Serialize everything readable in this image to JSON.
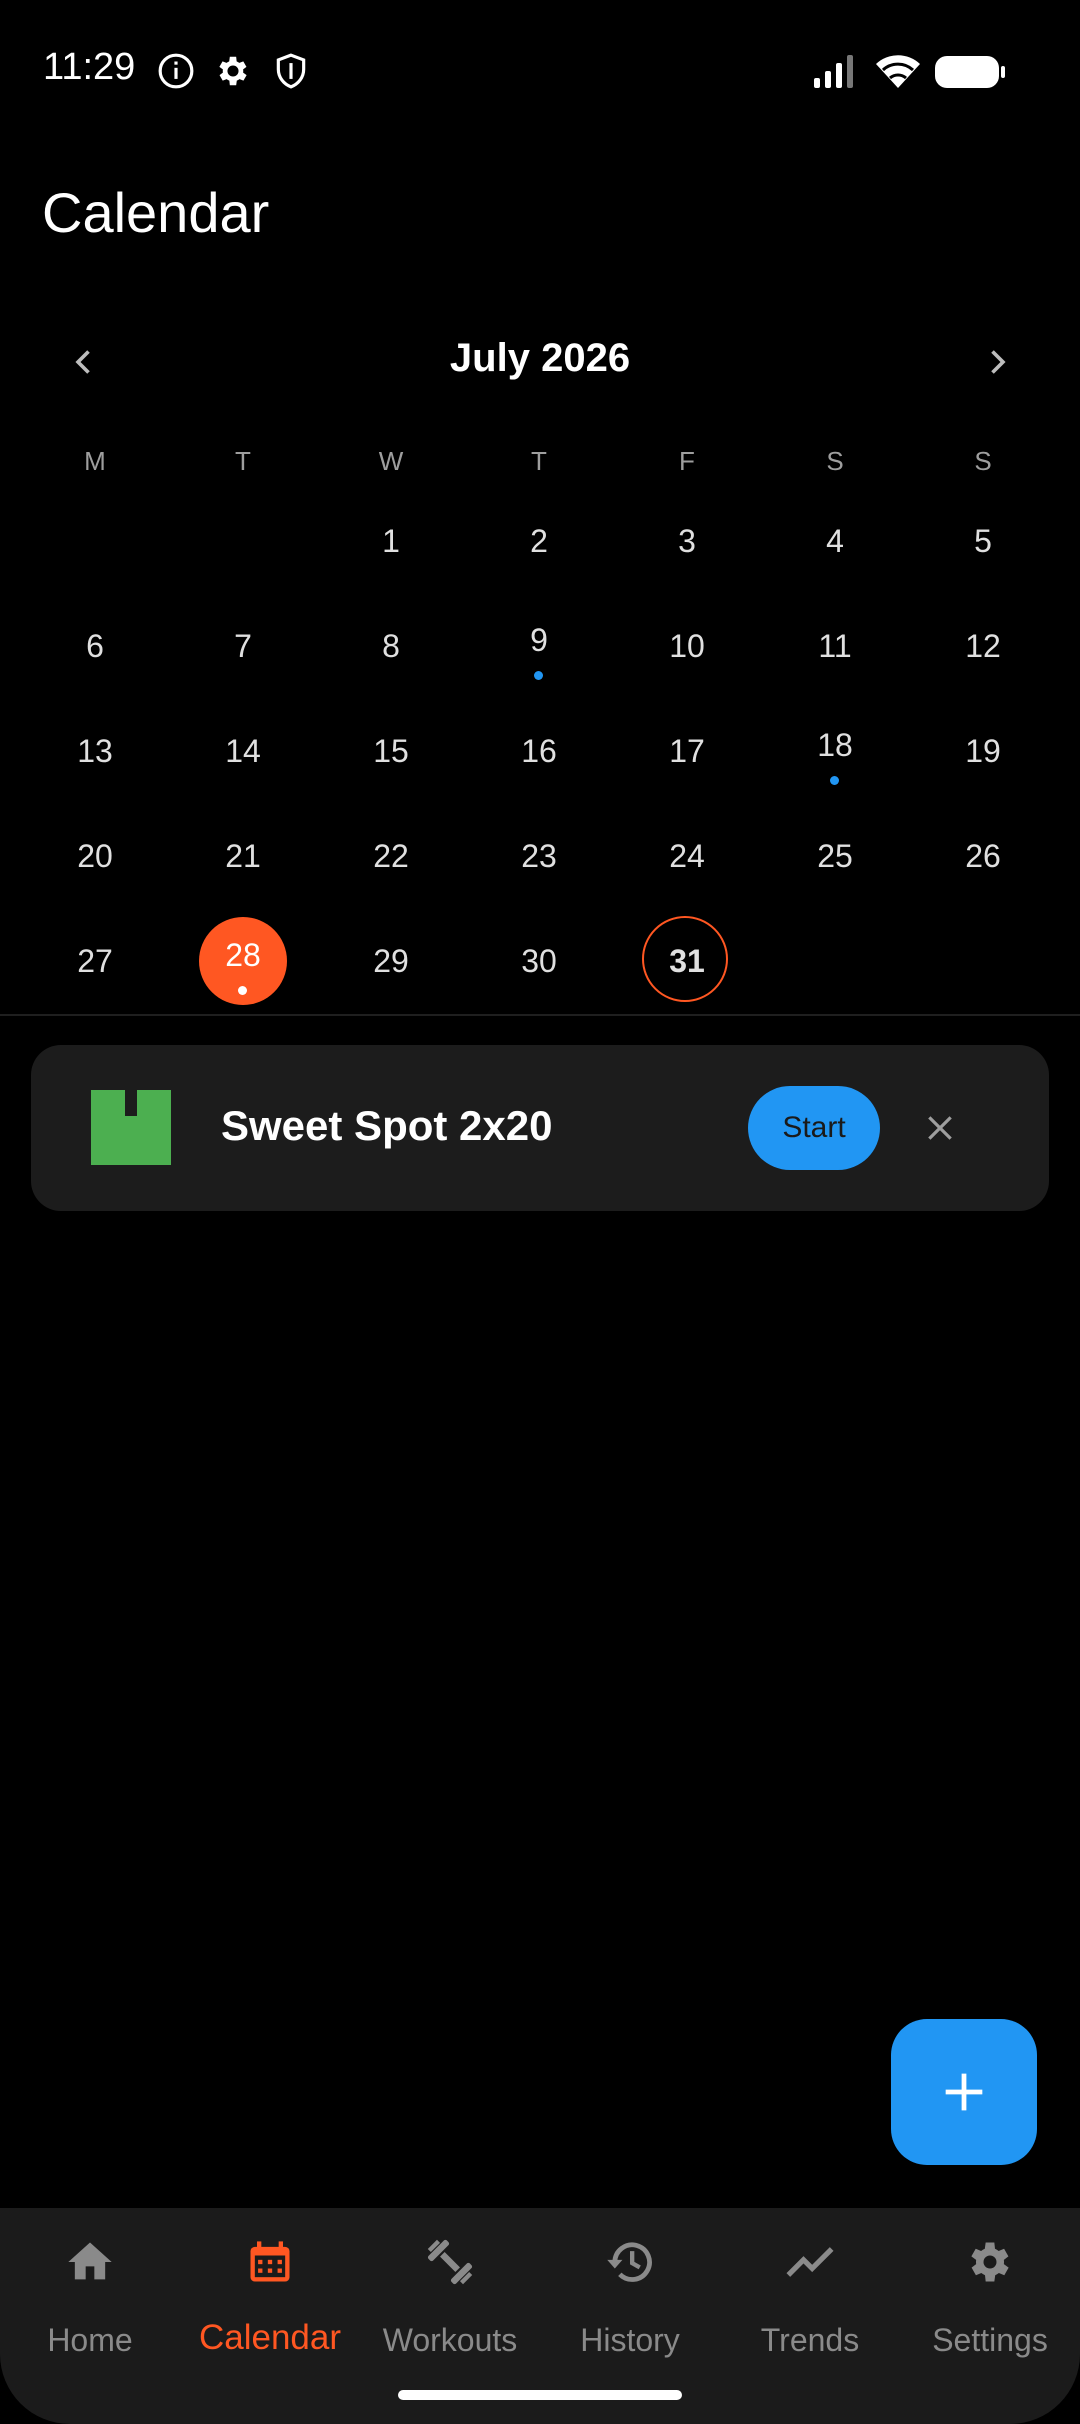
{
  "status": {
    "time": "11:29"
  },
  "header": {
    "title": "Calendar"
  },
  "calendar": {
    "month_label": "July 2026",
    "weekdays": [
      "M",
      "T",
      "W",
      "T",
      "F",
      "S",
      "S"
    ],
    "days": [
      "1",
      "2",
      "3",
      "4",
      "5",
      "6",
      "7",
      "8",
      "9",
      "10",
      "11",
      "12",
      "13",
      "14",
      "15",
      "16",
      "17",
      "18",
      "19",
      "20",
      "21",
      "22",
      "23",
      "24",
      "25",
      "26",
      "27",
      "28",
      "29",
      "30",
      "31"
    ],
    "selected_day": "28",
    "today": "31",
    "days_with_workouts": [
      "9",
      "18",
      "28"
    ]
  },
  "workout": {
    "title": "Sweet Spot 2x20",
    "start_label": "Start",
    "icon_color": "#4caf50"
  },
  "nav": {
    "items": [
      {
        "label": "Home",
        "icon": "home-icon"
      },
      {
        "label": "Calendar",
        "icon": "calendar-icon"
      },
      {
        "label": "Workouts",
        "icon": "dumbbell-icon"
      },
      {
        "label": "History",
        "icon": "history-icon"
      },
      {
        "label": "Trends",
        "icon": "trend-icon"
      },
      {
        "label": "Settings",
        "icon": "gear-icon"
      }
    ],
    "active": "Calendar"
  },
  "colors": {
    "accent": "#ff5722",
    "primary": "#2196f3",
    "background": "#000000"
  }
}
